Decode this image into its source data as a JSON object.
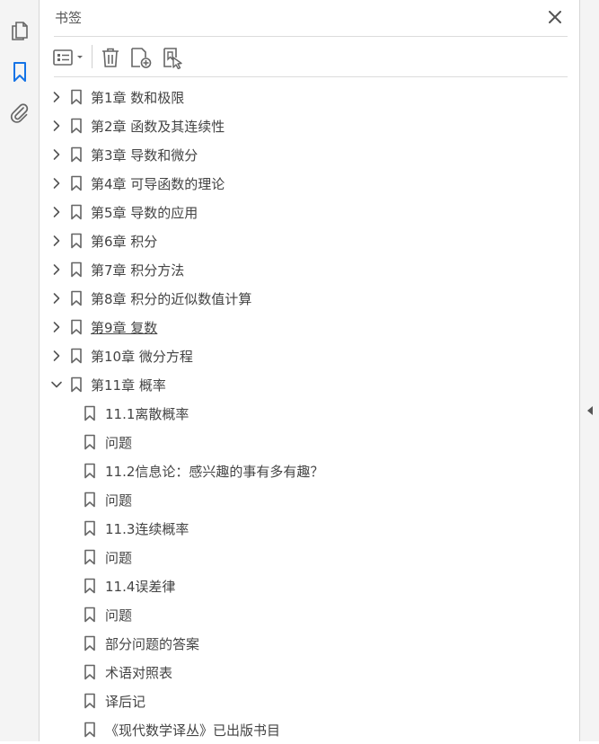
{
  "panel": {
    "title": "书签"
  },
  "bookmarks": [
    {
      "label": "第1章  数和极限",
      "expanded": false,
      "level": 0
    },
    {
      "label": "第2章  函数及其连续性",
      "expanded": false,
      "level": 0
    },
    {
      "label": "第3章  导数和微分",
      "expanded": false,
      "level": 0
    },
    {
      "label": "第4章  可导函数的理论",
      "expanded": false,
      "level": 0
    },
    {
      "label": "第5章  导数的应用",
      "expanded": false,
      "level": 0
    },
    {
      "label": "第6章  积分",
      "expanded": false,
      "level": 0
    },
    {
      "label": "第7章  积分方法",
      "expanded": false,
      "level": 0
    },
    {
      "label": "第8章  积分的近似数值计算",
      "expanded": false,
      "level": 0
    },
    {
      "label": "第9章  复数",
      "expanded": false,
      "level": 0,
      "hovered": true
    },
    {
      "label": "第10章  微分方程",
      "expanded": false,
      "level": 0
    },
    {
      "label": "第11章  概率",
      "expanded": true,
      "level": 0
    },
    {
      "label": "11.1离散概率",
      "level": 1
    },
    {
      "label": "问题",
      "level": 1
    },
    {
      "label": "11.2信息论：感兴趣的事有多有趣？",
      "level": 1
    },
    {
      "label": "问题",
      "level": 1
    },
    {
      "label": "11.3连续概率",
      "level": 1
    },
    {
      "label": "问题",
      "level": 1
    },
    {
      "label": "11.4误差律",
      "level": 1
    },
    {
      "label": "问题",
      "level": 1
    },
    {
      "label": "部分问题的答案",
      "level": 1
    },
    {
      "label": "术语对照表",
      "level": 1
    },
    {
      "label": "译后记",
      "level": 1
    },
    {
      "label": "《现代数学译丛》已出版书目",
      "level": 1
    }
  ],
  "icons": {
    "rail": [
      "pages-icon",
      "bookmark-icon",
      "attachment-icon"
    ],
    "toolbar": [
      "options-menu-icon",
      "delete-icon",
      "new-bookmark-icon",
      "bookmark-from-structure-icon"
    ]
  },
  "colors": {
    "accent": "#1473e6",
    "icon": "#666666",
    "text": "#444444"
  }
}
